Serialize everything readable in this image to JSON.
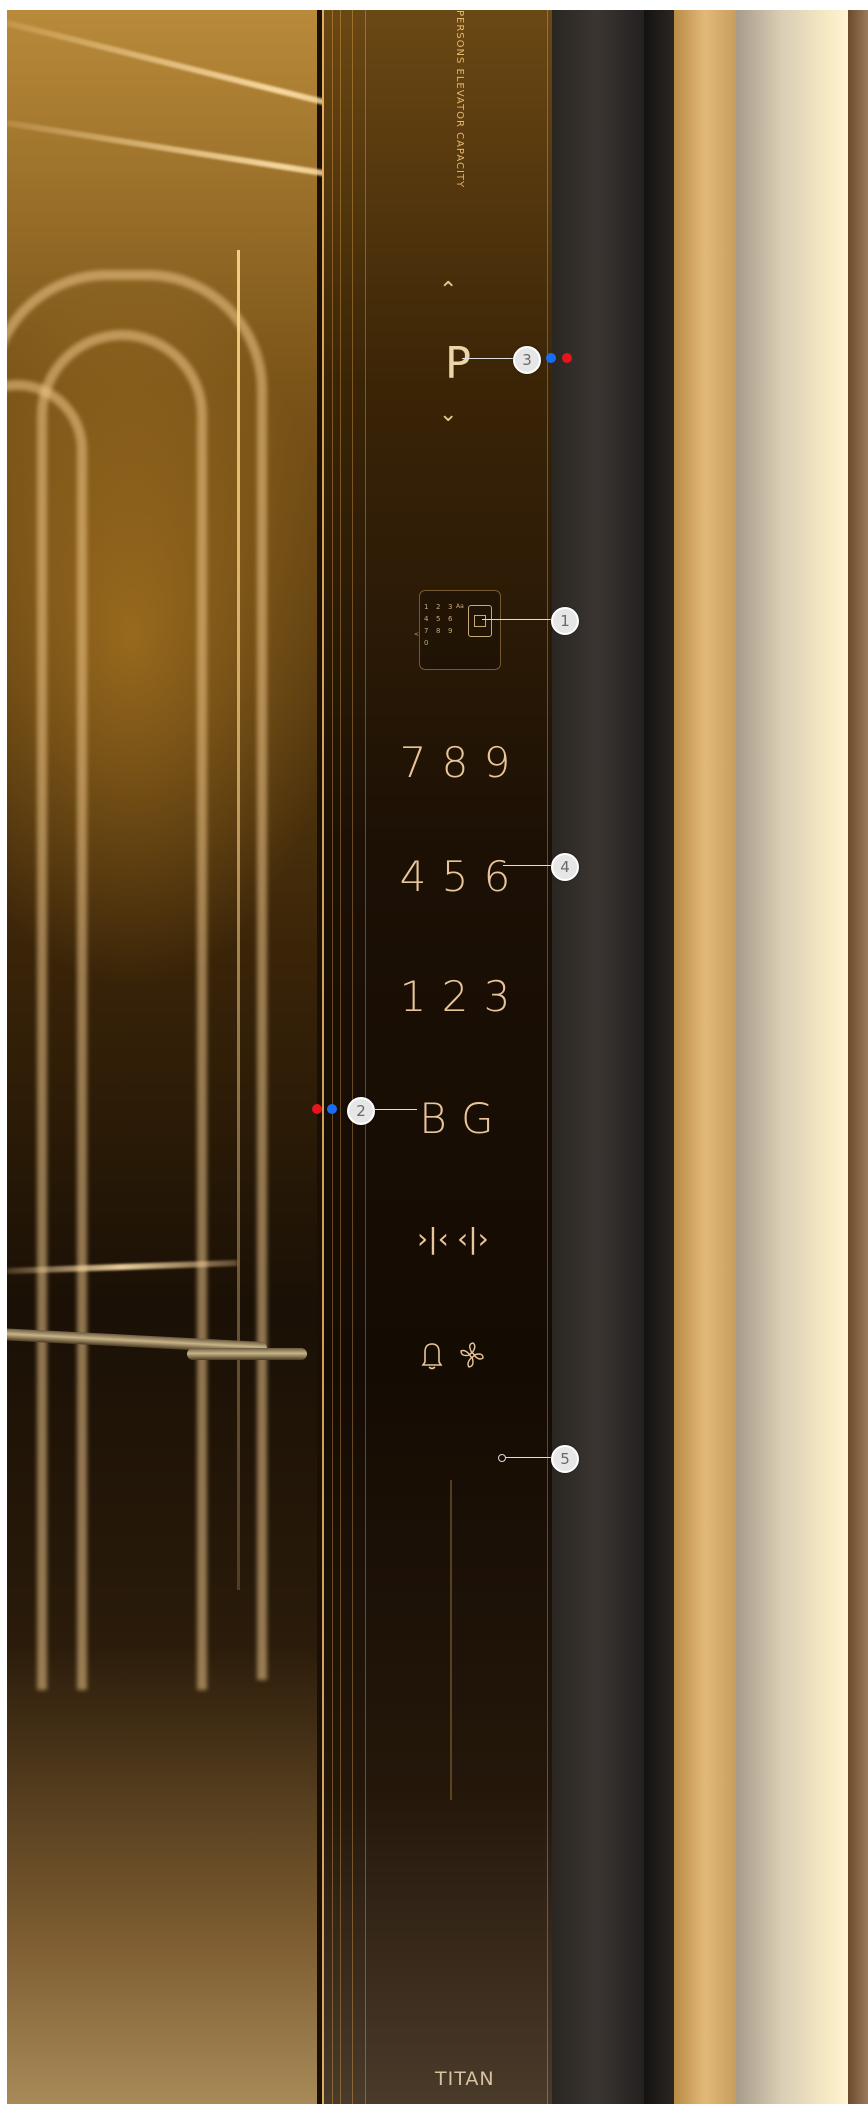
{
  "panel": {
    "capacity_label": "PERSONS ELEVATOR CAPACITY",
    "floor_indicator": {
      "up_arrow": "⌃",
      "display": "P",
      "down_arrow": "⌄"
    },
    "keypad": {
      "keys": [
        "1",
        "2",
        "3",
        "4",
        "5",
        "6",
        "7",
        "8",
        "9",
        "0"
      ],
      "extra_keys": [
        "Aa",
        "<"
      ]
    },
    "rows": [
      {
        "buttons": [
          "7",
          "8",
          "9"
        ]
      },
      {
        "buttons": [
          "4",
          "5",
          "6"
        ]
      },
      {
        "buttons": [
          "1",
          "2",
          "3"
        ]
      },
      {
        "buttons": [
          "B",
          "G"
        ]
      }
    ],
    "door_buttons": {
      "open": "›|‹",
      "close": "‹|›"
    },
    "alarm_icon": "alarm-bell-icon",
    "fan_icon": "fan-icon",
    "brand": "TITAN"
  },
  "callouts": [
    "1",
    "2",
    "3",
    "4",
    "5"
  ],
  "colors": {
    "gold_text": "#e9c59a",
    "callout_red": "#e8141b",
    "callout_blue": "#1a6cf5"
  }
}
